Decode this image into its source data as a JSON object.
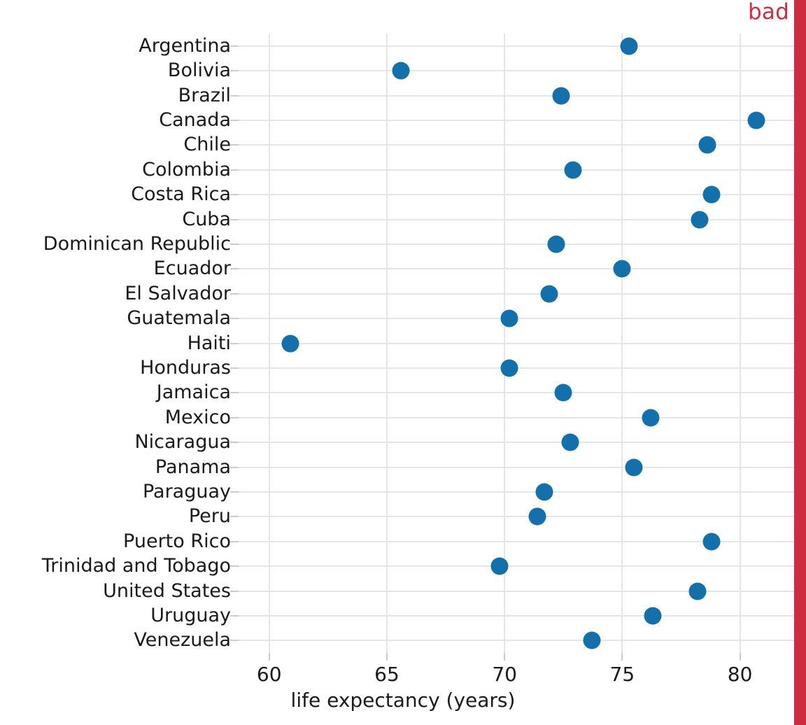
{
  "annotation": {
    "bad_label": "bad",
    "bad_color": "#D32B41",
    "rule_color": "#CE2B40"
  },
  "style": {
    "dot_color": "#1470AB",
    "grid_color": "#E6E6E6",
    "text_color": "#1A1A1A",
    "background": "#FFFFFF"
  },
  "chart_data": {
    "type": "scatter",
    "title": "",
    "subtitle": "",
    "xlabel": "life expectancy (years)",
    "ylabel": "",
    "xlim": [
      58.7,
      82.3
    ],
    "xticks": [
      60,
      65,
      70,
      75,
      80
    ],
    "xticklabels": [
      "60",
      "65",
      "70",
      "75",
      "80"
    ],
    "grid": "both",
    "legend": "none",
    "orientation": "horizontal",
    "categories": [
      "Argentina",
      "Bolivia",
      "Brazil",
      "Canada",
      "Chile",
      "Colombia",
      "Costa Rica",
      "Cuba",
      "Dominican Republic",
      "Ecuador",
      "El Salvador",
      "Guatemala",
      "Haiti",
      "Honduras",
      "Jamaica",
      "Mexico",
      "Nicaragua",
      "Panama",
      "Paraguay",
      "Peru",
      "Puerto Rico",
      "Trinidad and Tobago",
      "United States",
      "Uruguay",
      "Venezuela"
    ],
    "values": [
      75.3,
      65.6,
      72.4,
      80.7,
      78.6,
      72.9,
      78.8,
      78.3,
      72.2,
      75.0,
      71.9,
      70.2,
      60.9,
      70.2,
      72.5,
      76.2,
      72.8,
      75.5,
      71.7,
      71.4,
      78.8,
      69.8,
      78.2,
      76.3,
      73.7
    ],
    "points": [
      {
        "country": "Argentina",
        "life_expectancy": 75.3
      },
      {
        "country": "Bolivia",
        "life_expectancy": 65.6
      },
      {
        "country": "Brazil",
        "life_expectancy": 72.4
      },
      {
        "country": "Canada",
        "life_expectancy": 80.7
      },
      {
        "country": "Chile",
        "life_expectancy": 78.6
      },
      {
        "country": "Colombia",
        "life_expectancy": 72.9
      },
      {
        "country": "Costa Rica",
        "life_expectancy": 78.8
      },
      {
        "country": "Cuba",
        "life_expectancy": 78.3
      },
      {
        "country": "Dominican Republic",
        "life_expectancy": 72.2
      },
      {
        "country": "Ecuador",
        "life_expectancy": 75.0
      },
      {
        "country": "El Salvador",
        "life_expectancy": 71.9
      },
      {
        "country": "Guatemala",
        "life_expectancy": 70.2
      },
      {
        "country": "Haiti",
        "life_expectancy": 60.9
      },
      {
        "country": "Honduras",
        "life_expectancy": 70.2
      },
      {
        "country": "Jamaica",
        "life_expectancy": 72.5
      },
      {
        "country": "Mexico",
        "life_expectancy": 76.2
      },
      {
        "country": "Nicaragua",
        "life_expectancy": 72.8
      },
      {
        "country": "Panama",
        "life_expectancy": 75.5
      },
      {
        "country": "Paraguay",
        "life_expectancy": 71.7
      },
      {
        "country": "Peru",
        "life_expectancy": 71.4
      },
      {
        "country": "Puerto Rico",
        "life_expectancy": 78.8
      },
      {
        "country": "Trinidad and Tobago",
        "life_expectancy": 69.8
      },
      {
        "country": "United States",
        "life_expectancy": 78.2
      },
      {
        "country": "Uruguay",
        "life_expectancy": 76.3
      },
      {
        "country": "Venezuela",
        "life_expectancy": 73.7
      }
    ]
  }
}
